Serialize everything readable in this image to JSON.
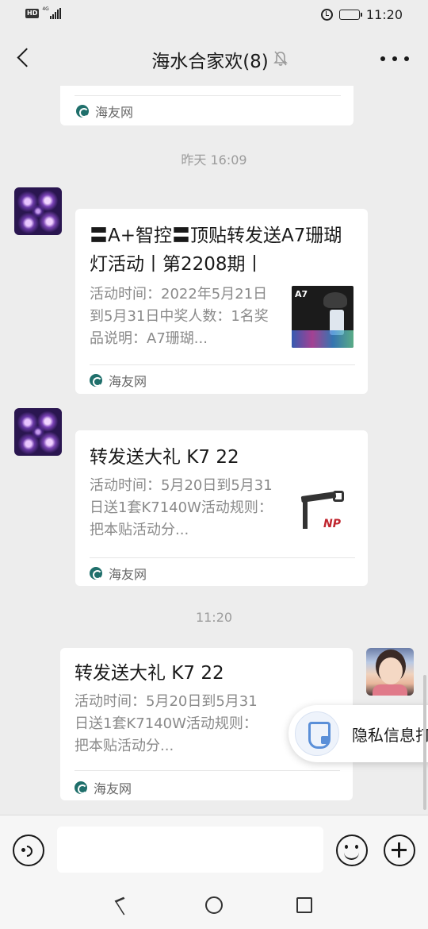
{
  "status_bar": {
    "hd_label": "HD",
    "network_label": "4G",
    "time": "11:20"
  },
  "nav": {
    "title": "海水合家欢(8)"
  },
  "messages": [
    {
      "source": "海友网"
    },
    {
      "timestamp": "昨天 16:09",
      "title": "〓A+智控〓顶贴转发送A7珊瑚灯活动丨第2208期丨",
      "description": "活动时间：2022年5月21日到5月31日中奖人数：1名奖品说明：A7珊瑚...",
      "thumb_label": "A7",
      "source": "海友网"
    },
    {
      "title": "转发送大礼 K7 22",
      "description": "活动时间：5月20日到5月31日送1套K7140W活动规则：把本贴活动分...",
      "thumb_label": "NP",
      "source": "海友网"
    },
    {
      "timestamp": "11:20",
      "title": "转发送大礼 K7 22",
      "description": "活动时间：5月20日到5月31日送1套K7140W活动规则：把本贴活动分...",
      "source": "海友网"
    }
  ],
  "privacy_popup": {
    "text": "隐私信息打"
  },
  "input": {
    "placeholder": ""
  }
}
